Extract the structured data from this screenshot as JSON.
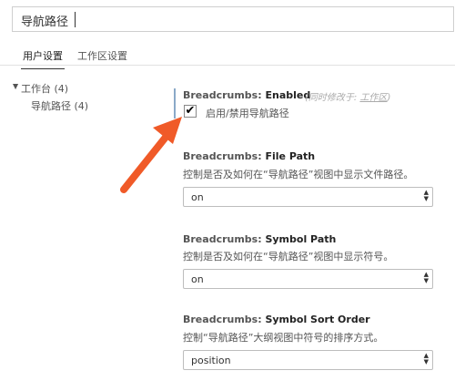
{
  "search": {
    "value": "导航路径"
  },
  "tabs": [
    {
      "label": "用户设置",
      "active": true
    },
    {
      "label": "工作区设置",
      "active": false
    }
  ],
  "tree": {
    "root": {
      "label": "工作台 (4)"
    },
    "child": {
      "label": "导航路径 (4)"
    }
  },
  "settings": {
    "enabled": {
      "category": "Breadcrumbs: ",
      "name": "Enabled",
      "modified_prefix": "(同时修改于: ",
      "modified_link": "工作区",
      "modified_suffix": ")",
      "checkbox_label": "启用/禁用导航路径",
      "checked": true,
      "check_glyph": "✔"
    },
    "file_path": {
      "category": "Breadcrumbs: ",
      "name": "File Path",
      "description": "控制是否及如何在“导航路径”视图中显示文件路径。",
      "value": "on"
    },
    "symbol_path": {
      "category": "Breadcrumbs: ",
      "name": "Symbol Path",
      "description": "控制是否及如何在“导航路径”视图中显示符号。",
      "value": "on"
    },
    "symbol_sort_order": {
      "category": "Breadcrumbs: ",
      "name": "Symbol Sort Order",
      "description": "控制“导航路径”大纲视图中符号的排序方式。",
      "value": "position"
    }
  },
  "colors": {
    "annotation_arrow": "#f05a28",
    "modified_bar": "#8aa9c8"
  },
  "icons": {
    "tree_caret": "▲",
    "select_up": "▲",
    "select_down": "▼"
  }
}
